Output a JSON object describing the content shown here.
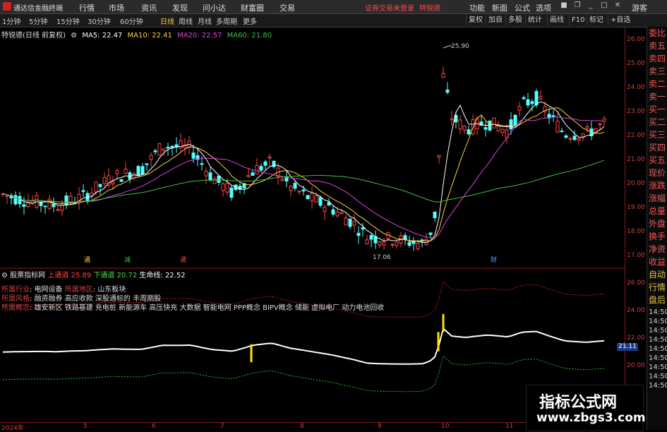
{
  "menubar": {
    "app_title": "通达信金融终端",
    "items": [
      "行情",
      "市场",
      "资讯",
      "发现",
      "问小达",
      "财富圈",
      "交易"
    ],
    "notice": "证券交易未登录",
    "stock_name": "特锐德",
    "right_items": [
      "功能",
      "新面",
      "公式",
      "选项",
      "游客"
    ]
  },
  "toolbar": {
    "periods": [
      "1分钟",
      "5分钟",
      "15分钟",
      "30分钟",
      "60分钟",
      "日线",
      "周线",
      "月线",
      "多周期",
      "更多"
    ],
    "active_period": "日线",
    "right_buttons": [
      "复权",
      "加自",
      "多股",
      "统计",
      "画线",
      "F10",
      "标记",
      "+自选"
    ]
  },
  "main_info": {
    "title": "特锐德(日线 前复权)",
    "ma5": "MA5: 22.47",
    "ma10": "MA10: 22.41",
    "ma20": "MA20: 22.57",
    "ma60": "MA60: 21.80",
    "high_label": "25.90",
    "low_label": "17.06",
    "markers": [
      "通",
      "减",
      "通",
      "财"
    ]
  },
  "y_axis_main": [
    "26.00",
    "25.00",
    "24.00",
    "23.00",
    "22.00",
    "21.00",
    "20.00",
    "19.00",
    "18.00",
    "17.00"
  ],
  "y_axis_sub": [
    "26.00",
    "24.00",
    "22.00",
    "20.00"
  ],
  "sub_value_box": "21.11",
  "x_axis": [
    "2024年",
    "5",
    "6",
    "7",
    "8",
    "9",
    "10",
    "11"
  ],
  "right_panel": [
    "委比",
    "卖五",
    "卖四",
    "卖三",
    "卖二",
    "卖一",
    "买一",
    "买二",
    "买三",
    "买四",
    "买五",
    "现价",
    "涨跌",
    "涨幅",
    "总量",
    "外盘",
    "换手",
    "净资",
    "收益",
    "自动",
    "行情",
    "盘后",
    "14:50",
    "14:50",
    "14:50",
    "14:50",
    "14:50",
    "14:50",
    "14:50",
    "14:50",
    "14:50"
  ],
  "indicator": {
    "name": "股票指标网",
    "upper_label": "上通道",
    "upper_value": "25.89",
    "lower_label": "下通道",
    "lower_value": "20.72",
    "life_label": "生命线",
    "life_value": "22.52",
    "industry_label": "所属行业",
    "industry_value": "电网设备",
    "region_label": "所属地区",
    "region_value": "山东板块",
    "style_label": "所属风格",
    "style_value": "融资融券 高应收款 深股通标的 丰周期股",
    "concept_label": "所属概念",
    "concept_value": "雄安新区 铁路基建 充电桩 新能源车 高压快充 大数据 智能电网 PPP概念 BIPV概念 储能 虚拟电厂 动力电池回收"
  },
  "watermark": {
    "line1": "指标公式网",
    "line2": "www.zbgs3.com"
  },
  "colors": {
    "up": "#ff4444",
    "down": "#54ffff",
    "ma5": "#ffffff",
    "ma10": "#ffd23c",
    "ma20": "#e040e0",
    "ma60": "#40c040"
  }
}
